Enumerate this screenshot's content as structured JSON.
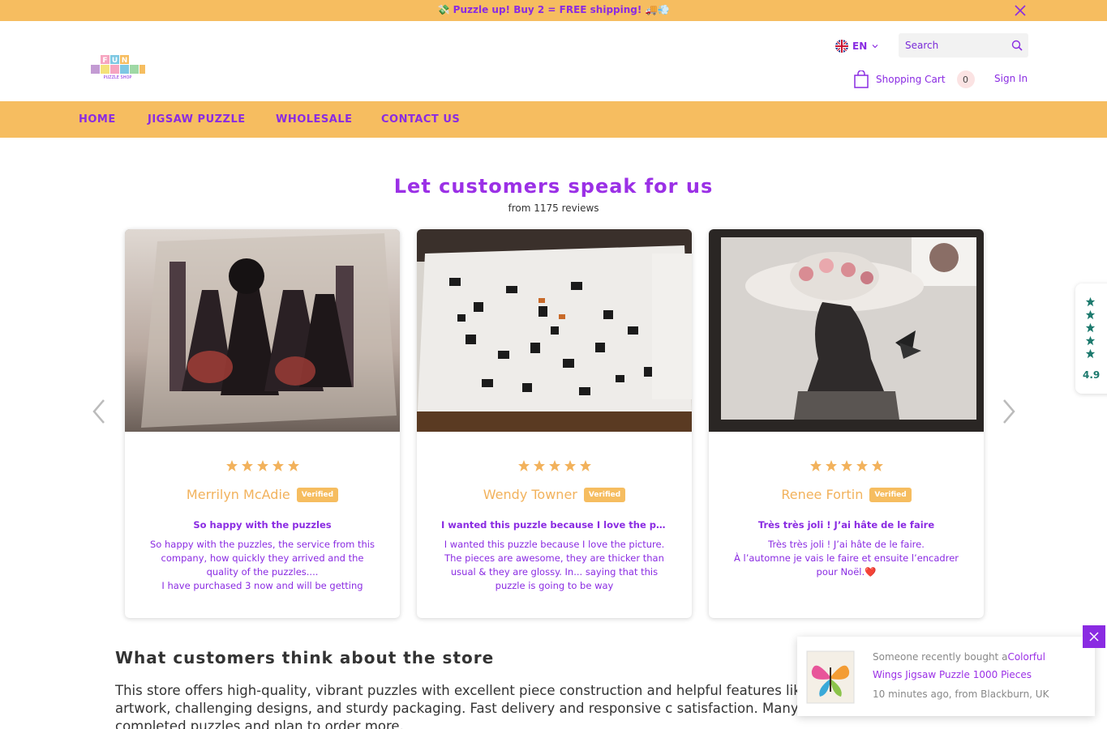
{
  "announcement": {
    "text": "💸 Puzzle up! Buy 2 = FREE shipping! 🚚💨"
  },
  "header": {
    "language": "EN",
    "search_placeholder": "Search",
    "cart_label": "Shopping Cart",
    "cart_count": "0",
    "signin_label": "Sign In"
  },
  "nav": {
    "items": [
      {
        "label": "HOME"
      },
      {
        "label": "JIGSAW PUZZLE"
      },
      {
        "label": "WHOLESALE"
      },
      {
        "label": "CONTACT US"
      }
    ]
  },
  "reviews": {
    "title": "Let customers speak for us",
    "subtitle": "from 1175 reviews",
    "verified_label": "Verified",
    "cards": [
      {
        "name": "Merrilyn McAdie",
        "rating": 5,
        "title": "So happy with the puzzles",
        "body": "So happy with the puzzles, the service from this company, how quickly they arrived and the quality of the puzzles....\nI have purchased 3 now and will be getting"
      },
      {
        "name": "Wendy Towner",
        "rating": 5,
        "title": "I wanted this puzzle because I love the pi...",
        "body": "I wanted this puzzle because I love the picture. The pieces are awesome, they are thicker than usual & they are glossy. In... saying that this puzzle is going to be way"
      },
      {
        "name": "Renee Fortin",
        "rating": 5,
        "title": "Très très joli ! J’ai hâte de le faire",
        "body": "Très très joli ! J’ai hâte de le faire.\nÀ l’automne je vais le faire et ensuite l’encadrer pour Noël.❤️"
      }
    ]
  },
  "rating_badge": {
    "score": "4.9",
    "stars": 5
  },
  "store_summary": {
    "title": "What customers think about the store",
    "body": "This store offers high-quality, vibrant puzzles with excellent piece construction and helpful features like praise the beautiful artwork, challenging designs, and sturdy packaging. Fast delivery and responsive c satisfaction. Many customers frame completed puzzles and plan to order more."
  },
  "popup": {
    "prefix": "Someone recently bought a",
    "product": "Colorful Wings Jigsaw Puzzle 1000 Pieces",
    "meta": "10 minutes ago, from Blackburn, UK"
  },
  "colors": {
    "accent": "#f6bd60",
    "brand_purple": "#8a2be2",
    "star": "#f2b25c",
    "badge_star": "#1d7a6e"
  }
}
